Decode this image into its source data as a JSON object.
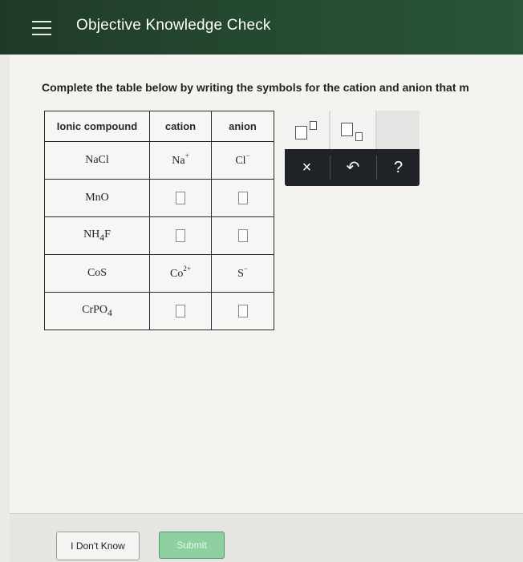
{
  "header": {
    "title": "Objective Knowledge Check",
    "menu_icon": "hamburger-menu-icon",
    "color": "#24462f"
  },
  "instruction": "Complete the table below by writing the symbols for the cation and anion that m",
  "table": {
    "headers": [
      "Ionic compound",
      "cation",
      "anion"
    ],
    "rows": [
      {
        "compound": {
          "base": "NaCl",
          "sub": "",
          "tail": ""
        },
        "cation": {
          "filled": true,
          "base": "Na",
          "sup": "+"
        },
        "anion": {
          "filled": true,
          "base": "Cl",
          "sup": "−"
        }
      },
      {
        "compound": {
          "base": "MnO",
          "sub": "",
          "tail": ""
        },
        "cation": {
          "filled": false
        },
        "anion": {
          "filled": false
        }
      },
      {
        "compound": {
          "base": "NH",
          "sub": "4",
          "tail": "F"
        },
        "cation": {
          "filled": false
        },
        "anion": {
          "filled": false
        }
      },
      {
        "compound": {
          "base": "CoS",
          "sub": "",
          "tail": ""
        },
        "cation": {
          "filled": true,
          "base": "Co",
          "sup": "2+"
        },
        "anion": {
          "filled": true,
          "base": "S",
          "sup": "−"
        }
      },
      {
        "compound": {
          "base": "CrPO",
          "sub": "4",
          "tail": ""
        },
        "cation": {
          "filled": false
        },
        "anion": {
          "filled": false
        }
      }
    ]
  },
  "palette": {
    "buttons": [
      "superscript-icon",
      "subscript-icon"
    ],
    "clear_label": "×",
    "undo_label": "↶",
    "help_label": "?"
  },
  "footer": {
    "dont_know_label": "I Don't Know",
    "submit_label": "Submit",
    "submit_color": "#8fd0a0"
  }
}
